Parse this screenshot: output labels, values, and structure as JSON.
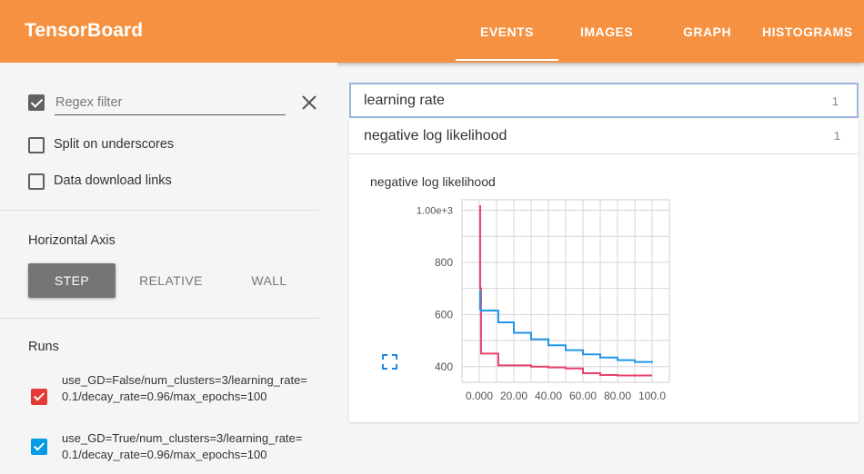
{
  "app": {
    "title": "TensorBoard"
  },
  "tabs": [
    {
      "label": "EVENTS",
      "active": true
    },
    {
      "label": "IMAGES",
      "active": false
    },
    {
      "label": "GRAPH",
      "active": false
    },
    {
      "label": "HISTOGRAMS",
      "active": false
    }
  ],
  "sidebar": {
    "regex": {
      "checked": true,
      "placeholder": "Regex filter"
    },
    "split_underscores": {
      "label": "Split on underscores",
      "checked": false
    },
    "download_links": {
      "label": "Data download links",
      "checked": false
    },
    "horizontal_axis": {
      "title": "Horizontal Axis",
      "options": [
        "STEP",
        "RELATIVE",
        "WALL"
      ],
      "selected": "STEP"
    },
    "runs": {
      "title": "Runs",
      "items": [
        {
          "label": "use_GD=False/num_clusters=3/learning_rate=0.1/decay_rate=0.96/max_epochs=100",
          "color": "#e53935",
          "checked": true
        },
        {
          "label": "use_GD=True/num_clusters=3/learning_rate=0.1/decay_rate=0.96/max_epochs=100",
          "color": "#039be5",
          "checked": true
        }
      ]
    }
  },
  "categories": [
    {
      "name": "learning rate",
      "count": "1",
      "selected": true
    },
    {
      "name": "negative log likelihood",
      "count": "1",
      "selected": false
    }
  ],
  "chart_data": {
    "type": "line",
    "title": "negative log likelihood",
    "xlabel": "",
    "ylabel": "",
    "xlim": [
      -10,
      110
    ],
    "ylim": [
      340,
      1040
    ],
    "x_ticks": [
      "0.000",
      "20.00",
      "40.00",
      "60.00",
      "80.00",
      "100.0"
    ],
    "x_tick_values": [
      0,
      20,
      40,
      60,
      80,
      100
    ],
    "y_ticks": [
      "400",
      "600",
      "800",
      "1.00e+3"
    ],
    "y_tick_values": [
      400,
      600,
      800,
      1000
    ],
    "grid": true,
    "series": [
      {
        "color": "#e8416b",
        "x": [
          0,
          0.5,
          1,
          10,
          11,
          20,
          30,
          40,
          50,
          60,
          70,
          80,
          90,
          100
        ],
        "y": [
          1015,
          700,
          450,
          450,
          405,
          405,
          400,
          397,
          393,
          375,
          368,
          366,
          366,
          366
        ]
      },
      {
        "color": "#2196e6",
        "x": [
          0,
          0.5,
          1,
          10,
          11,
          20,
          30,
          40,
          50,
          60,
          70,
          80,
          90,
          100
        ],
        "y": [
          690,
          620,
          615,
          615,
          570,
          530,
          505,
          482,
          463,
          447,
          435,
          425,
          418,
          415
        ]
      }
    ]
  }
}
